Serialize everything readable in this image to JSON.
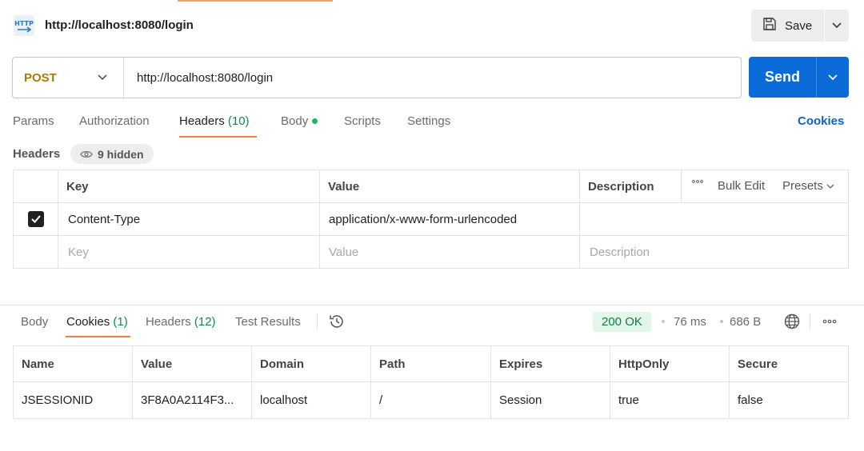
{
  "request": {
    "title": "http://localhost:8080/login",
    "method": "POST",
    "url": "http://localhost:8080/login",
    "save_label": "Save",
    "send_label": "Send"
  },
  "request_tabs": {
    "params": "Params",
    "authorization": "Authorization",
    "headers": "Headers",
    "headers_count": "(10)",
    "body": "Body",
    "scripts": "Scripts",
    "settings": "Settings",
    "cookies": "Cookies"
  },
  "headers_section": {
    "label": "Headers",
    "hidden": "9 hidden",
    "columns": {
      "key": "Key",
      "value": "Value",
      "description": "Description"
    },
    "bulk_edit": "Bulk Edit",
    "presets": "Presets",
    "rows": [
      {
        "key": "Content-Type",
        "value": "application/x-www-form-urlencoded",
        "description": ""
      }
    ],
    "placeholder": {
      "key": "Key",
      "value": "Value",
      "description": "Description"
    }
  },
  "response_tabs": {
    "body": "Body",
    "cookies": "Cookies",
    "cookies_count": "(1)",
    "headers": "Headers",
    "headers_count": "(12)",
    "test_results": "Test Results"
  },
  "response_meta": {
    "status": "200 OK",
    "time": "76 ms",
    "size": "686 B"
  },
  "cookies_table": {
    "columns": [
      "Name",
      "Value",
      "Domain",
      "Path",
      "Expires",
      "HttpOnly",
      "Secure"
    ],
    "rows": [
      [
        "JSESSIONID",
        "3F8A0A2114F3...",
        "localhost",
        "/",
        "Session",
        "true",
        "false"
      ]
    ]
  },
  "colors": {
    "method": "#ad7a03",
    "send": "#0a6ad8",
    "active_tab_underline": "#f07e44",
    "status_ok": "#117a43",
    "cookies_link": "#0b63c5"
  },
  "icons": [
    "http-icon",
    "save-icon",
    "chevron-down-icon",
    "eye-icon",
    "check-icon",
    "more-icon",
    "history-icon",
    "globe-icon"
  ]
}
